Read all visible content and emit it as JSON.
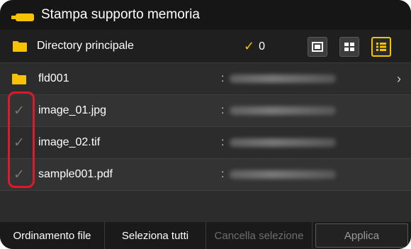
{
  "title": "Stampa supporto memoria",
  "directory": {
    "label": "Directory principale",
    "selected_count": "0"
  },
  "view_modes": [
    "preview",
    "thumbnails",
    "list"
  ],
  "active_view": "list",
  "files": [
    {
      "name": "fld001",
      "type": "folder",
      "separator": ":"
    },
    {
      "name": "image_01.jpg",
      "type": "file",
      "separator": ":"
    },
    {
      "name": "image_02.tif",
      "type": "file",
      "separator": ":"
    },
    {
      "name": "sample001.pdf",
      "type": "file",
      "separator": ":"
    }
  ],
  "buttons": {
    "sort": "Ordinamento file",
    "select_all": "Seleziona tutti",
    "clear_selection": "Cancella selezione",
    "apply": "Applica"
  },
  "colors": {
    "accent": "#f5c300",
    "highlight": "#e2172a"
  }
}
